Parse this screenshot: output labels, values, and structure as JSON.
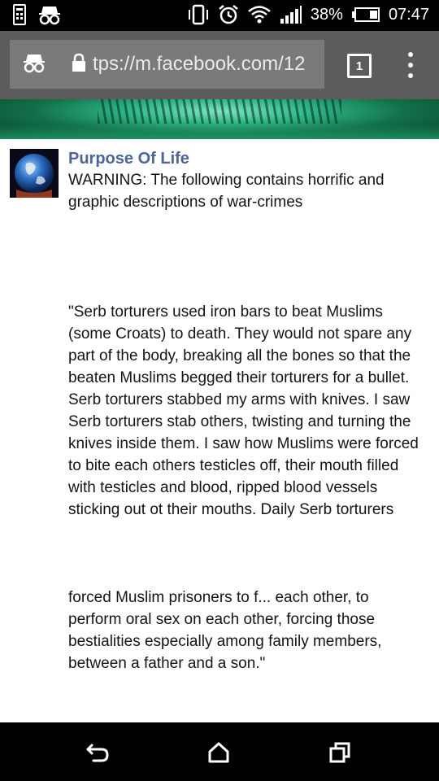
{
  "status_bar": {
    "battery_percent": "38%",
    "time": "07:47",
    "icons": [
      "sim-card-icon",
      "incognito-icon",
      "vibrate-icon",
      "alarm-icon",
      "wifi-icon",
      "signal-icon",
      "battery-icon"
    ]
  },
  "browser": {
    "url": "tps://m.facebook.com/12",
    "tab_count": "1",
    "icons": [
      "incognito-icon",
      "lock-icon",
      "menu-icon"
    ]
  },
  "post": {
    "author": "Purpose Of Life",
    "warning": "WARNING: The following contains horrific and graphic descriptions of war-crimes",
    "paragraph_1": "\"Serb torturers used iron bars to beat Muslims (some Croats) to death. They would not spare any part of the body, breaking all the bones so that the beaten Muslims begged their torturers for a bullet. Serb torturers stabbed my arms with knives. I saw Serb torturers stab others, twisting and turning the knives inside them. I saw how Muslims were forced to bite each others testicles off, their mouth filled with testicles and blood, ripped blood vessels sticking out ot their mouths. Daily Serb torturers",
    "paragraph_2": "forced Muslim prisoners to f... each other, to perform oral sex on each other, forcing those bestialities especially among family members, between a father and a son.\""
  },
  "nav_bar": {
    "icons": [
      "back-icon",
      "home-icon",
      "recents-icon"
    ]
  }
}
